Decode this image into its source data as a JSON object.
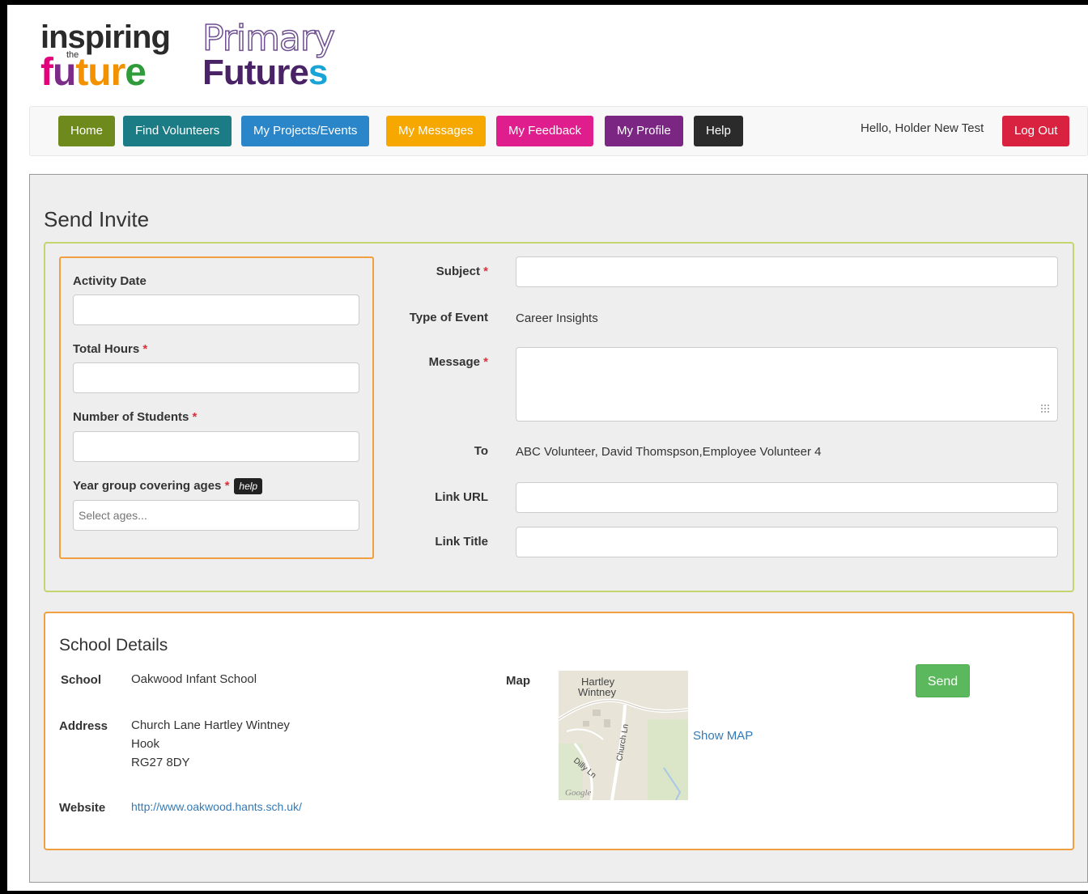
{
  "brand": {
    "inspiring": "inspiring",
    "the": "the",
    "future_parts": [
      "f",
      "u",
      "tur",
      "e"
    ],
    "primary": "Primary",
    "futures_main": "Future",
    "futures_s": "s"
  },
  "nav": {
    "items": [
      {
        "label": "Home",
        "color": "#6f8a1c"
      },
      {
        "label": "Find Volunteers",
        "color": "#1b7c85"
      },
      {
        "label": "My Projects/Events",
        "color": "#2a85c9"
      },
      {
        "label": "My Messages",
        "color": "#f7a800"
      },
      {
        "label": "My Feedback",
        "color": "#e01d8c"
      },
      {
        "label": "My Profile",
        "color": "#7a2682"
      },
      {
        "label": "Help",
        "color": "#2b2b2b"
      }
    ],
    "greeting": "Hello, Holder New Test",
    "logout_label": "Log Out",
    "logout_color": "#d9223f"
  },
  "page": {
    "title": "Send Invite"
  },
  "form": {
    "activity_date_label": "Activity Date",
    "total_hours_label": "Total Hours",
    "students_label": "Number of Students",
    "year_group_label": "Year group covering ages",
    "help_label": "help",
    "ages_placeholder": "Select ages...",
    "required_mark": "*",
    "subject_label": "Subject",
    "type_label": "Type of Event",
    "type_value": "Career Insights",
    "message_label": "Message",
    "to_label": "To",
    "to_value": "ABC Volunteer, David Thomspson,Employee Volunteer 4",
    "link_url_label": "Link URL",
    "link_title_label": "Link Title"
  },
  "school": {
    "section_title": "School Details",
    "school_label": "School",
    "school_value": "Oakwood Infant School",
    "address_label": "Address",
    "address_lines": [
      "Church Lane Hartley Wintney",
      "Hook",
      "RG27 8DY"
    ],
    "website_label": "Website",
    "website_value": "http://www.oakwood.hants.sch.uk/",
    "map_label": "Map",
    "map_place": [
      "Hartley",
      "Wintney"
    ],
    "map_roads": [
      "Church Ln",
      "Dilly Ln"
    ],
    "map_brand": "Google",
    "show_map_label": "Show MAP",
    "send_label": "Send"
  }
}
